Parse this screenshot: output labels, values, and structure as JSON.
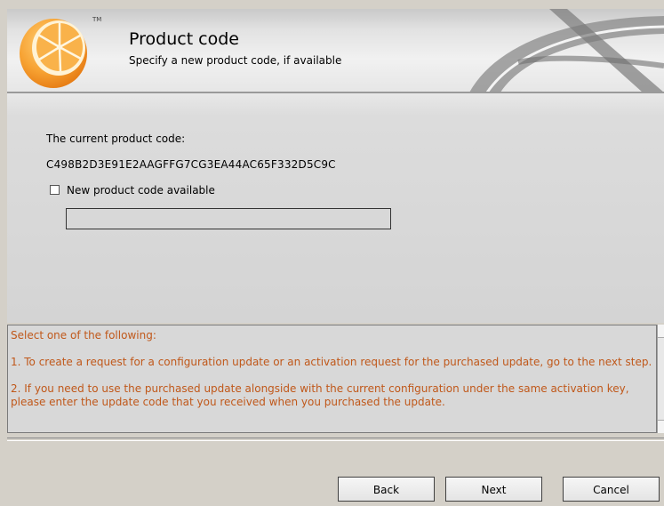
{
  "header": {
    "title": "Product code",
    "subtitle": "Specify a new product code, if available",
    "trademark": "TM",
    "logo_icon": "orange-slice-logo-icon"
  },
  "content": {
    "current_label": "The current product code:",
    "current_code": "C498B2D3E91E2AAGFFG7CG3EA44AC65F332D5C9C",
    "checkbox_label": "New product code available",
    "checkbox_checked": false,
    "new_code_value": ""
  },
  "info": {
    "line1": "Select one of the following:",
    "line2": "1. To create a request for a configuration update or an activation request for the purchased update, go to the next step.",
    "line3": "2. If you need to use the purchased update alongside with the current configuration under the same activation key, please enter the update code that you received when you purchased the update."
  },
  "buttons": {
    "back": "Back",
    "next": "Next",
    "cancel": "Cancel"
  },
  "colors": {
    "info_text": "#c0581a",
    "logo_orange": "#f59a2a"
  }
}
